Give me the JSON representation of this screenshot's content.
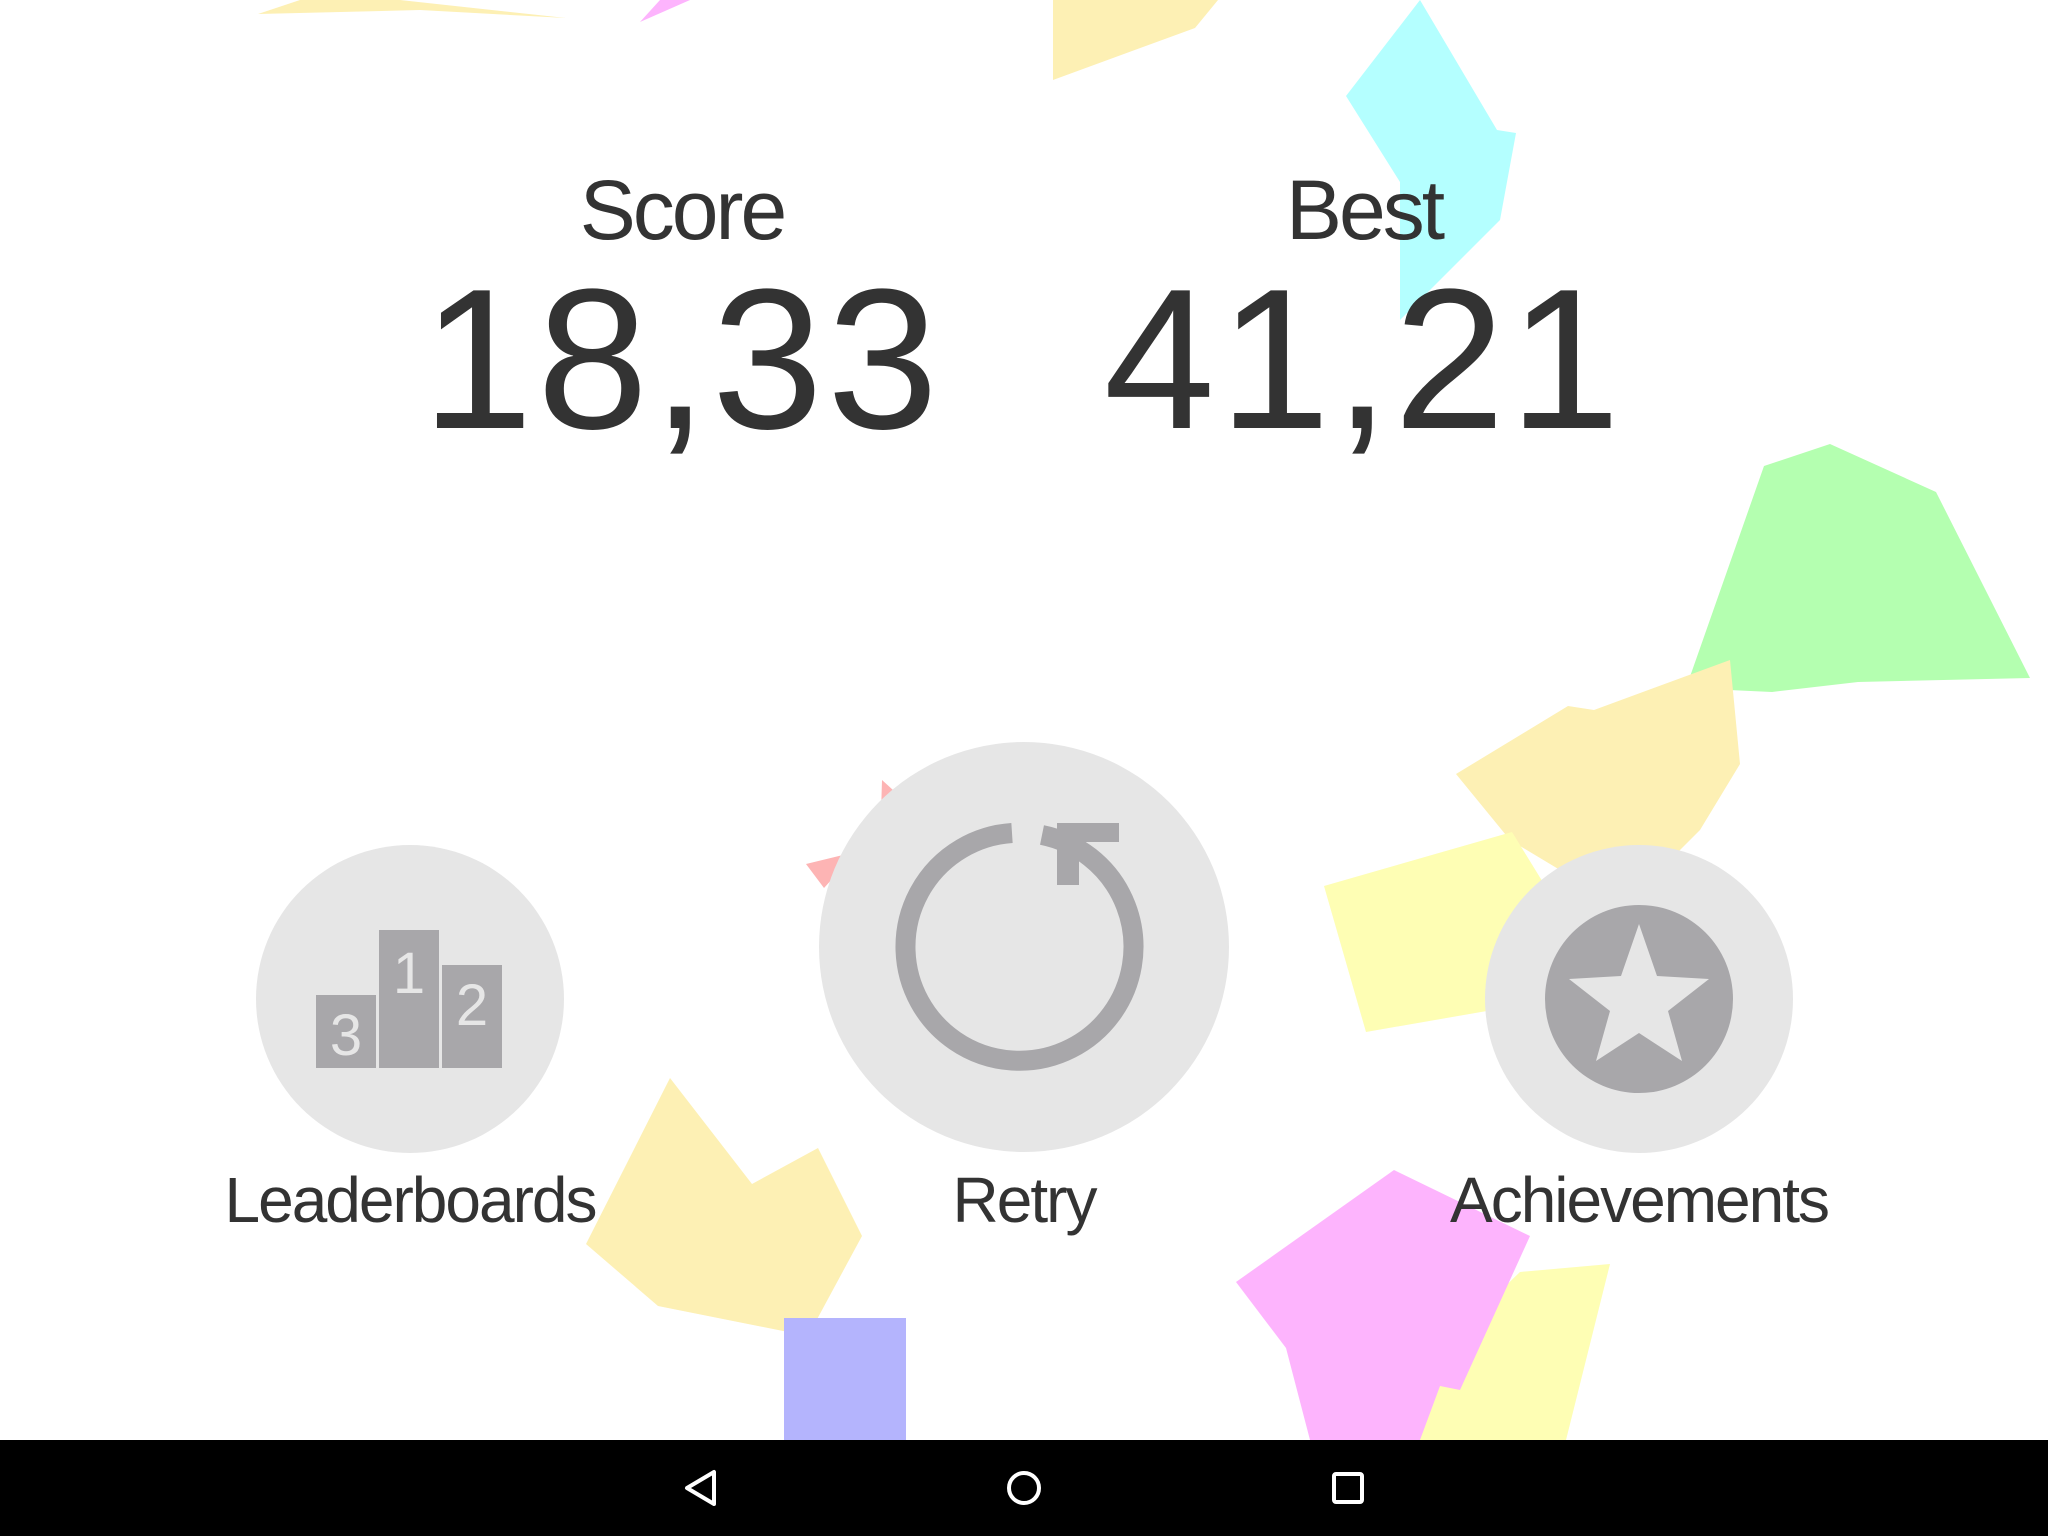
{
  "score": {
    "label": "Score",
    "value": "18,33"
  },
  "best": {
    "label": "Best",
    "value": "41,21"
  },
  "buttons": {
    "leaderboards": {
      "label": "Leaderboards",
      "icon": "podium-icon",
      "podium_numbers": [
        "3",
        "1",
        "2"
      ]
    },
    "retry": {
      "label": "Retry",
      "icon": "retry-icon"
    },
    "achievements": {
      "label": "Achievements",
      "icon": "star-icon"
    }
  },
  "navbar": {
    "back_icon": "back-icon",
    "home_icon": "home-icon",
    "recents_icon": "recents-icon"
  },
  "colors": {
    "background": "#ffffff",
    "button_bg": "#e6e6e6",
    "icon_gray": "#a8a7aa",
    "text": "#333333",
    "shape_yellow": "#fdf0b4",
    "shape_pale_yellow": "#fefeb4",
    "shape_cyan": "#b4ffff",
    "shape_green": "#b4ffb0",
    "shape_magenta": "#fdb4fd",
    "shape_blue": "#b4b4fd",
    "shape_red": "#fdb4b4"
  }
}
